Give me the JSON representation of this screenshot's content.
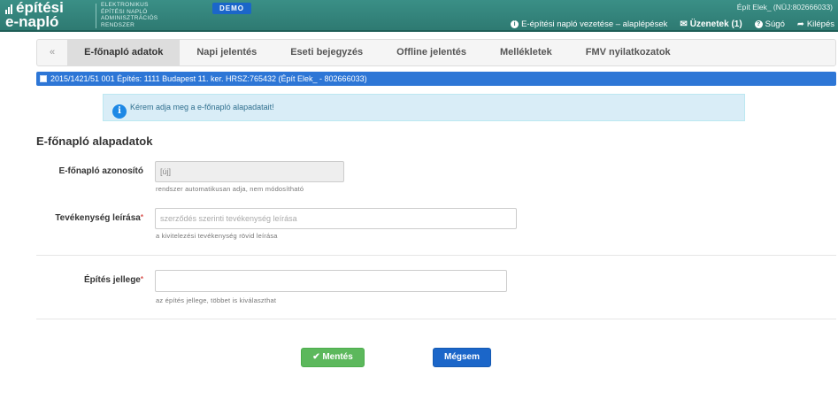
{
  "header": {
    "logo": {
      "line1": "építési",
      "line2": "e-napló",
      "sub1": "ELEKTRONIKUS",
      "sub2": "ÉPÍTÉSI NAPLÓ",
      "sub3": "ADMINISZTRÁCIÓS",
      "sub4": "RENDSZER"
    },
    "demo_badge": "DEMO",
    "user": "Épít Elek_ (NÜJ:802666033)",
    "nav": {
      "guide": "E-építési napló vezetése – alaplépések",
      "messages": "Üzenetek (1)",
      "help": "Súgó",
      "logout": "Kilépés"
    }
  },
  "tabs": [
    {
      "label": "«"
    },
    {
      "label": "E-főnapló adatok"
    },
    {
      "label": "Napi jelentés"
    },
    {
      "label": "Eseti bejegyzés"
    },
    {
      "label": "Offline jelentés"
    },
    {
      "label": "Mellékletek"
    },
    {
      "label": "FMV nyilatkozatok"
    }
  ],
  "project_strip": "2015/1421/51 001 Építés: 1111 Budapest 11. ker. HRSZ:765432 (Épít Elek_ - 802666033)",
  "alert": {
    "text": "Kérem adja meg a e-főnapló alapadatait!"
  },
  "form": {
    "title": "E-főnapló alapadatok",
    "id_field": {
      "label": "E-főnapló azonosító",
      "value": "[új]",
      "help": "rendszer automatikusan adja, nem módosítható"
    },
    "desc_field": {
      "label": "Tevékenység leírása",
      "required": "*",
      "placeholder": "szerződés szerinti tevékenység leírása",
      "help": "a kivitelezési tevékenység rövid leírása"
    },
    "type_field": {
      "label": "Építés jellege",
      "required": "*",
      "value": "",
      "help": "az építés jellege, többet is kiválaszthat"
    }
  },
  "buttons": {
    "save": "✔ Mentés",
    "cancel": "Mégsem"
  },
  "colors": {
    "header": "#2e7a72",
    "strip": "#2d76d6",
    "save": "#5cb85c",
    "cancel": "#1b66c9"
  }
}
